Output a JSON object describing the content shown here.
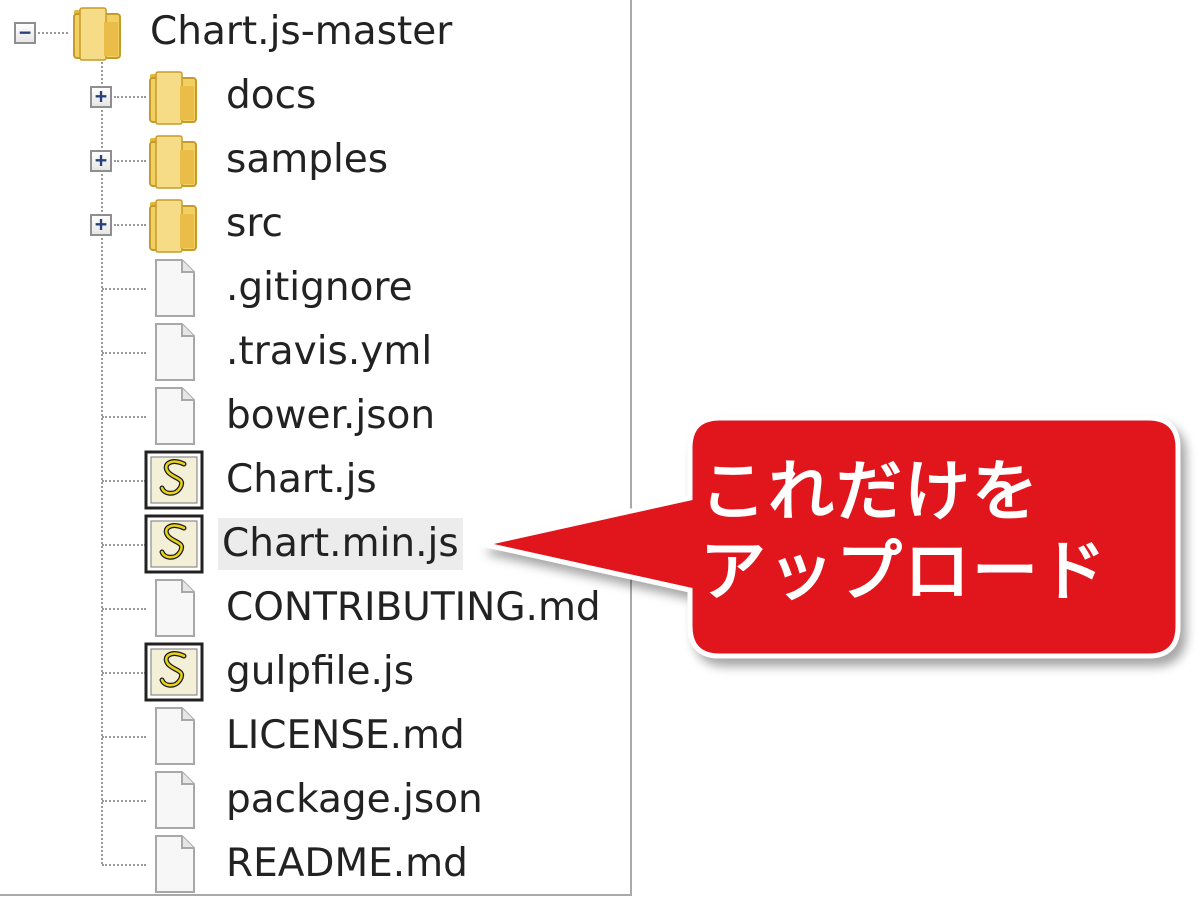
{
  "tree": {
    "root": {
      "label": "Chart.js-master",
      "expander": "−",
      "icon": "folder-icon"
    },
    "items": [
      {
        "label": "docs",
        "icon": "folder-icon",
        "expander": "+"
      },
      {
        "label": "samples",
        "icon": "folder-icon",
        "expander": "+"
      },
      {
        "label": "src",
        "icon": "folder-icon",
        "expander": "+"
      },
      {
        "label": ".gitignore",
        "icon": "file-icon"
      },
      {
        "label": ".travis.yml",
        "icon": "file-icon"
      },
      {
        "label": "bower.json",
        "icon": "file-icon"
      },
      {
        "label": "Chart.js",
        "icon": "script-file-icon"
      },
      {
        "label": "Chart.min.js",
        "icon": "script-file-icon",
        "selected": true
      },
      {
        "label": "CONTRIBUTING.md",
        "icon": "file-icon"
      },
      {
        "label": "gulpfile.js",
        "icon": "script-file-icon"
      },
      {
        "label": "LICENSE.md",
        "icon": "file-icon"
      },
      {
        "label": "package.json",
        "icon": "file-icon"
      },
      {
        "label": "README.md",
        "icon": "file-icon"
      }
    ]
  },
  "callout": {
    "line1": "これだけを",
    "line2": "アップロード",
    "color": "#e0141e"
  }
}
